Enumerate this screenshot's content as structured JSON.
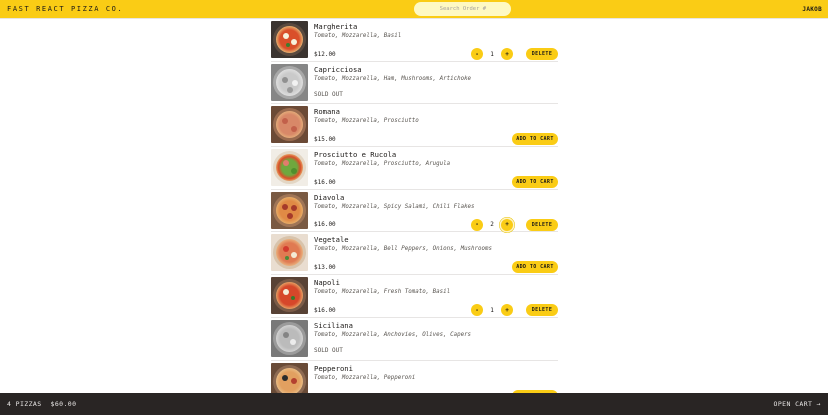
{
  "header": {
    "logo": "Fast React Pizza Co.",
    "search_placeholder": "Search Order #",
    "username": "JAKOB"
  },
  "menu": {
    "items": [
      {
        "name": "Margherita",
        "ingredients": "Tomato, Mozzarella, Basil",
        "price": "$12.00",
        "sold_out": false,
        "in_cart": true,
        "quantity": "1"
      },
      {
        "name": "Capricciosa",
        "ingredients": "Tomato, Mozzarella, Ham, Mushrooms, Artichoke",
        "price": "",
        "sold_out": true,
        "sold_out_label": "Sold out",
        "in_cart": false
      },
      {
        "name": "Romana",
        "ingredients": "Tomato, Mozzarella, Prosciutto",
        "price": "$15.00",
        "sold_out": false,
        "in_cart": false
      },
      {
        "name": "Prosciutto e Rucola",
        "ingredients": "Tomato, Mozzarella, Prosciutto, Arugula",
        "price": "$16.00",
        "sold_out": false,
        "in_cart": false
      },
      {
        "name": "Diavola",
        "ingredients": "Tomato, Mozzarella, Spicy Salami, Chili Flakes",
        "price": "$16.00",
        "sold_out": false,
        "in_cart": true,
        "quantity": "2"
      },
      {
        "name": "Vegetale",
        "ingredients": "Tomato, Mozzarella, Bell Peppers, Onions, Mushrooms",
        "price": "$13.00",
        "sold_out": false,
        "in_cart": false
      },
      {
        "name": "Napoli",
        "ingredients": "Tomato, Mozzarella, Fresh Tomato, Basil",
        "price": "$16.00",
        "sold_out": false,
        "in_cart": true,
        "quantity": "1"
      },
      {
        "name": "Siciliana",
        "ingredients": "Tomato, Mozzarella, Anchovies, Olives, Capers",
        "price": "",
        "sold_out": true,
        "sold_out_label": "Sold out",
        "in_cart": false
      },
      {
        "name": "Pepperoni",
        "ingredients": "Tomato, Mozzarella, Pepperoni",
        "price": "",
        "sold_out": false,
        "in_cart": false
      }
    ],
    "labels": {
      "decrease": "-",
      "increase": "+",
      "delete": "Delete",
      "add_to_cart": "Add to cart"
    }
  },
  "cart": {
    "pizza_count": "4 pizzas",
    "total": "$60.00",
    "open_cart": "Open cart →"
  },
  "colors": {
    "accent": "#facc15",
    "cart_bar": "#292524"
  }
}
